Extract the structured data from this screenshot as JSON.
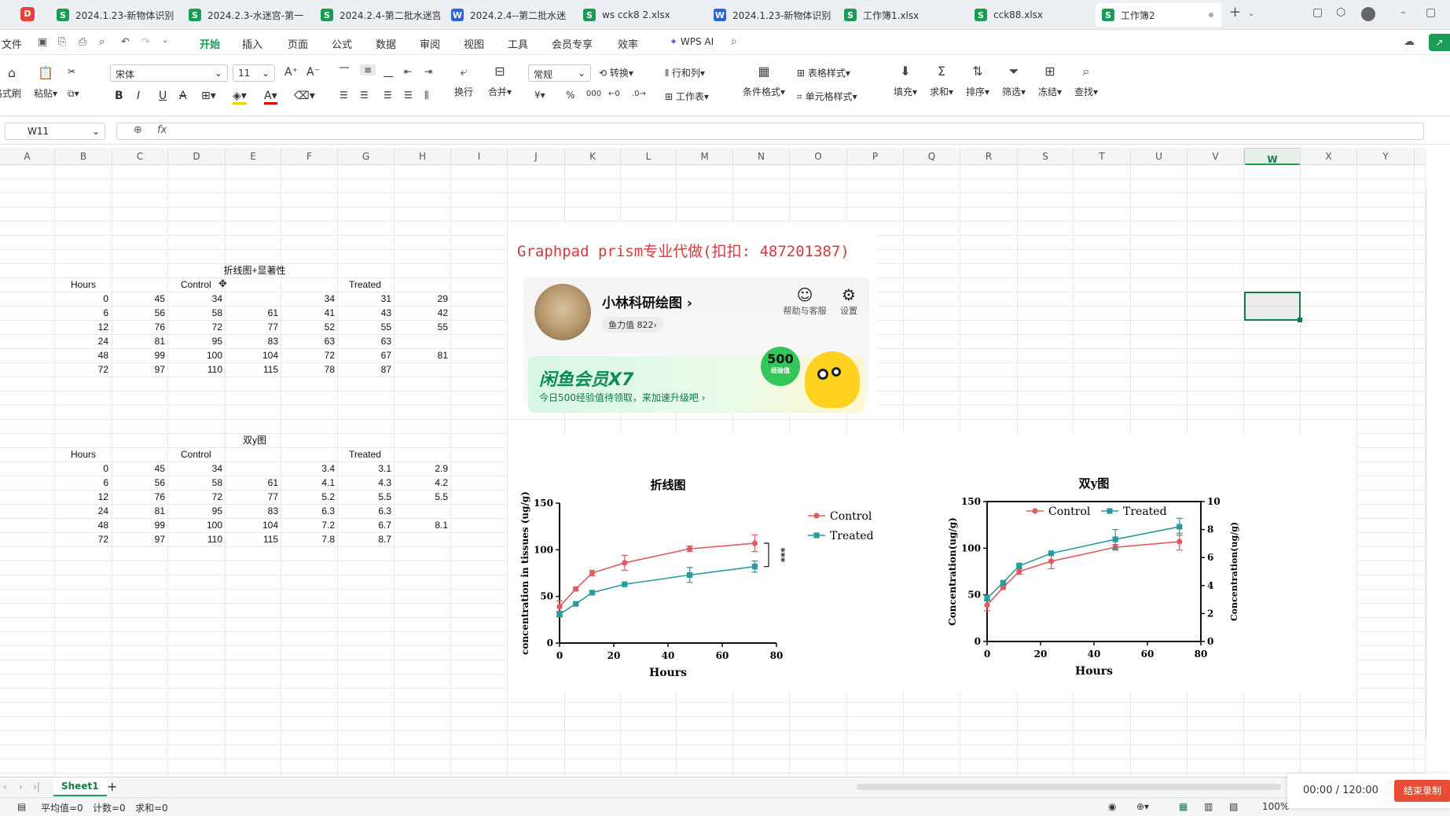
{
  "tabs": [
    {
      "label": "2024.1.23-新物体识别",
      "type": "S"
    },
    {
      "label": "2024.2.3-水迷宫-第一",
      "type": "S"
    },
    {
      "label": "2024.2.4-第二批水迷宫",
      "type": "S"
    },
    {
      "label": "2024.2.4--第二批水迷",
      "type": "W"
    },
    {
      "label": "ws cck8  2.xlsx",
      "type": "S"
    },
    {
      "label": "2024.1.23-新物体识别",
      "type": "W"
    },
    {
      "label": "工作簿1.xlsx",
      "type": "S"
    },
    {
      "label": "cck88.xlsx",
      "type": "S"
    },
    {
      "label": "工作簿2",
      "type": "S",
      "active": true
    }
  ],
  "menu": {
    "file": "文件",
    "items": [
      "开始",
      "插入",
      "页面",
      "公式",
      "数据",
      "审阅",
      "视图",
      "工具",
      "会员专享",
      "效率"
    ],
    "wps_ai": "WPS AI"
  },
  "ribbon": {
    "format_painter": "格式刷",
    "paste": "粘贴",
    "font_name": "宋体",
    "font_size": "11",
    "wrap": "换行",
    "merge": "合并",
    "number_format": "常规",
    "convert": "转换",
    "row_col": "行和列",
    "worksheet": "工作表",
    "cond_format": "条件格式",
    "table_style": "表格样式",
    "cell_style": "单元格样式",
    "fill": "填充",
    "sum": "求和",
    "sort": "排序",
    "filter": "筛选",
    "freeze": "冻结",
    "find": "查找"
  },
  "formula_bar": {
    "cell_ref": "W11",
    "fx": "fx",
    "value": ""
  },
  "columns": [
    "A",
    "B",
    "C",
    "D",
    "E",
    "F",
    "G",
    "H",
    "I",
    "J",
    "K",
    "L",
    "M",
    "N",
    "O",
    "P",
    "Q",
    "R",
    "S",
    "T",
    "U",
    "V",
    "W",
    "X",
    "Y"
  ],
  "selected_column": "W",
  "table1": {
    "title": "折线图+显著性",
    "hours_label": "Hours",
    "control_label": "Control",
    "treated_label": "Treated",
    "rows": [
      [
        "0",
        "45",
        "34",
        "",
        "34",
        "31",
        "29"
      ],
      [
        "6",
        "56",
        "58",
        "61",
        "41",
        "43",
        "42"
      ],
      [
        "12",
        "76",
        "72",
        "77",
        "52",
        "55",
        "55"
      ],
      [
        "24",
        "81",
        "95",
        "83",
        "63",
        "63",
        ""
      ],
      [
        "48",
        "99",
        "100",
        "104",
        "72",
        "67",
        "81"
      ],
      [
        "72",
        "97",
        "110",
        "115",
        "78",
        "87",
        ""
      ]
    ]
  },
  "table2": {
    "title": "双y图",
    "hours_label": "Hours",
    "control_label": "Control",
    "treated_label": "Treated",
    "rows": [
      [
        "0",
        "45",
        "34",
        "",
        "3.4",
        "3.1",
        "2.9"
      ],
      [
        "6",
        "56",
        "58",
        "61",
        "4.1",
        "4.3",
        "4.2"
      ],
      [
        "12",
        "76",
        "72",
        "77",
        "5.2",
        "5.5",
        "5.5"
      ],
      [
        "24",
        "81",
        "95",
        "83",
        "6.3",
        "6.3",
        ""
      ],
      [
        "48",
        "99",
        "100",
        "104",
        "7.2",
        "6.7",
        "8.1"
      ],
      [
        "72",
        "97",
        "110",
        "115",
        "7.8",
        "8.7",
        ""
      ]
    ]
  },
  "promo": {
    "banner": "Graphpad prism专业代做(扣扣: 487201387)",
    "username": "小林科研绘图",
    "fish_value": "鱼力值 822",
    "help": "帮助与客服",
    "settings": "设置",
    "vip_title": "闲鱼会员X7",
    "vip_desc": "今日500经验值待领取，来加速升级吧",
    "badge_num": "500",
    "badge_sub": "经验值"
  },
  "chart_data": [
    {
      "type": "line",
      "title": "折线图",
      "xlabel": "Hours",
      "ylabel": "concentration in tissues (ug/g)",
      "x": [
        0,
        6,
        12,
        24,
        48,
        72
      ],
      "xlim": [
        0,
        80
      ],
      "ylim": [
        0,
        150
      ],
      "xticks": [
        0,
        20,
        40,
        60,
        80
      ],
      "yticks": [
        0,
        50,
        100,
        150
      ],
      "legend": "right",
      "series": [
        {
          "name": "Control",
          "color": "#e05a5f",
          "values": [
            39,
            58,
            75,
            86,
            101,
            107
          ],
          "err": [
            6,
            2,
            3,
            8,
            3,
            9
          ]
        },
        {
          "name": "Treated",
          "color": "#2a9a9e",
          "values": [
            31,
            42,
            54,
            63,
            73,
            82
          ],
          "err": [
            3,
            1,
            2,
            0,
            8,
            6
          ]
        }
      ],
      "annotation": "***"
    },
    {
      "type": "line",
      "title": "双y图",
      "xlabel": "Hours",
      "ylabel": "Concentration(ug/g)",
      "y2label": "Concentration(ug/g)",
      "x": [
        0,
        6,
        12,
        24,
        48,
        72
      ],
      "xlim": [
        0,
        80
      ],
      "ylim": [
        0,
        150
      ],
      "y2lim": [
        0,
        10
      ],
      "xticks": [
        0,
        20,
        40,
        60,
        80
      ],
      "yticks": [
        0,
        50,
        100,
        150
      ],
      "y2ticks": [
        0,
        2,
        4,
        6,
        8,
        10
      ],
      "legend": "top",
      "series": [
        {
          "name": "Control",
          "color": "#e05a5f",
          "axis": "left",
          "values": [
            39,
            58,
            75,
            86,
            101,
            107
          ],
          "err": [
            6,
            2,
            3,
            8,
            3,
            9
          ]
        },
        {
          "name": "Treated",
          "color": "#2a9a9e",
          "axis": "right",
          "values": [
            3.1,
            4.2,
            5.4,
            6.3,
            7.3,
            8.2
          ],
          "err": [
            0.2,
            0.1,
            0.2,
            0,
            0.7,
            0.6
          ]
        }
      ]
    }
  ],
  "sheet_tab": "Sheet1",
  "status": {
    "avg": "平均值=0",
    "count": "计数=0",
    "sum": "求和=0",
    "zoom": "100%"
  },
  "recorder": {
    "time": "00:00 / 120:00",
    "stop": "结束录制"
  }
}
